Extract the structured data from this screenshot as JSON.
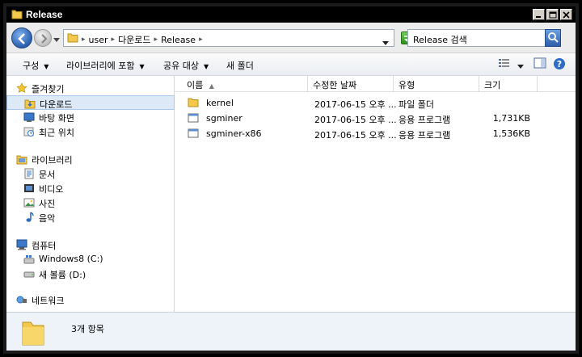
{
  "window": {
    "title": "Release"
  },
  "address": {
    "crumbs": [
      "user",
      "다운로드",
      "Release"
    ],
    "search_placeholder": "Release 검색"
  },
  "toolbar": {
    "organize": "구성",
    "include_library": "라이브러리에 포함",
    "share_with": "공유 대상",
    "new_folder": "새 폴더"
  },
  "nav": {
    "favorites": "즐겨찾기",
    "downloads": "다운로드",
    "desktop": "바탕 화면",
    "recent": "최근 위치",
    "libraries": "라이브러리",
    "documents": "문서",
    "videos": "비디오",
    "pictures": "사진",
    "music": "음악",
    "computer": "컴퓨터",
    "drive_c": "Windows8 (C:)",
    "drive_d": "새 볼륨 (D:)",
    "network": "네트워크"
  },
  "columns": {
    "name": "이름",
    "modified": "수정한 날짜",
    "type": "유형",
    "size": "크기"
  },
  "files": [
    {
      "name": "kernel",
      "modified": "2017-06-15 오후 ...",
      "type": "파일 폴더",
      "size": "",
      "icon": "folder-icon"
    },
    {
      "name": "sgminer",
      "modified": "2017-06-15 오후 ...",
      "type": "응용 프로그램",
      "size": "1,731KB",
      "icon": "application-icon"
    },
    {
      "name": "sgminer-x86",
      "modified": "2017-06-15 오후 ...",
      "type": "응용 프로그램",
      "size": "1,536KB",
      "icon": "application-icon"
    }
  ],
  "status": {
    "item_count": "3개 항목"
  }
}
